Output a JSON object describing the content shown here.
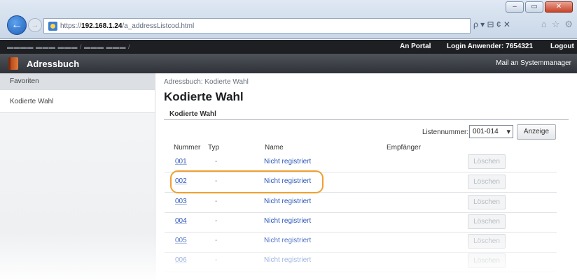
{
  "browser": {
    "url_prefix": "https://",
    "url_host": "192.168.1.24",
    "url_path": "/a_addressListcod.html",
    "search_tools": "ρ ▾ ⊟ ¢ ✕",
    "icons": [
      "back-icon",
      "forward-icon",
      "page-icon",
      "search-icon",
      "home-icon",
      "star-icon",
      "gear-icon"
    ]
  },
  "device": {
    "portal_link": "An Portal",
    "login_label": "Login Anwender:",
    "login_user": "7654321",
    "logout_link": "Logout"
  },
  "app": {
    "title": "Adressbuch",
    "mail_link": "Mail an Systemmanager"
  },
  "sidebar": {
    "items": [
      {
        "label": "Favoriten"
      },
      {
        "label": "Kodierte Wahl"
      }
    ]
  },
  "main": {
    "breadcrumb": "Adressbuch: Kodierte Wahl",
    "title": "Kodierte Wahl",
    "section_title": "Kodierte Wahl",
    "list_number_label": "Listennummer:",
    "list_number_value": "001-014",
    "show_button": "Anzeige",
    "columns": {
      "number": "Nummer",
      "type": "Typ",
      "name": "Name",
      "recipient": "Empfänger"
    },
    "rows": [
      {
        "number": "001",
        "type": "-",
        "name": "Nicht registriert",
        "delete": "Löschen"
      },
      {
        "number": "002",
        "type": "-",
        "name": "Nicht registriert",
        "delete": "Löschen"
      },
      {
        "number": "003",
        "type": "-",
        "name": "Nicht registriert",
        "delete": "Löschen"
      },
      {
        "number": "004",
        "type": "-",
        "name": "Nicht registriert",
        "delete": "Löschen"
      },
      {
        "number": "005",
        "type": "-",
        "name": "Nicht registriert",
        "delete": "Löschen"
      },
      {
        "number": "006",
        "type": "-",
        "name": "Nicht registriert",
        "delete": "Löschen"
      }
    ]
  },
  "colors": {
    "link": "#2b56b8",
    "highlight": "#f0a030",
    "header_dark": "#2f3238"
  }
}
